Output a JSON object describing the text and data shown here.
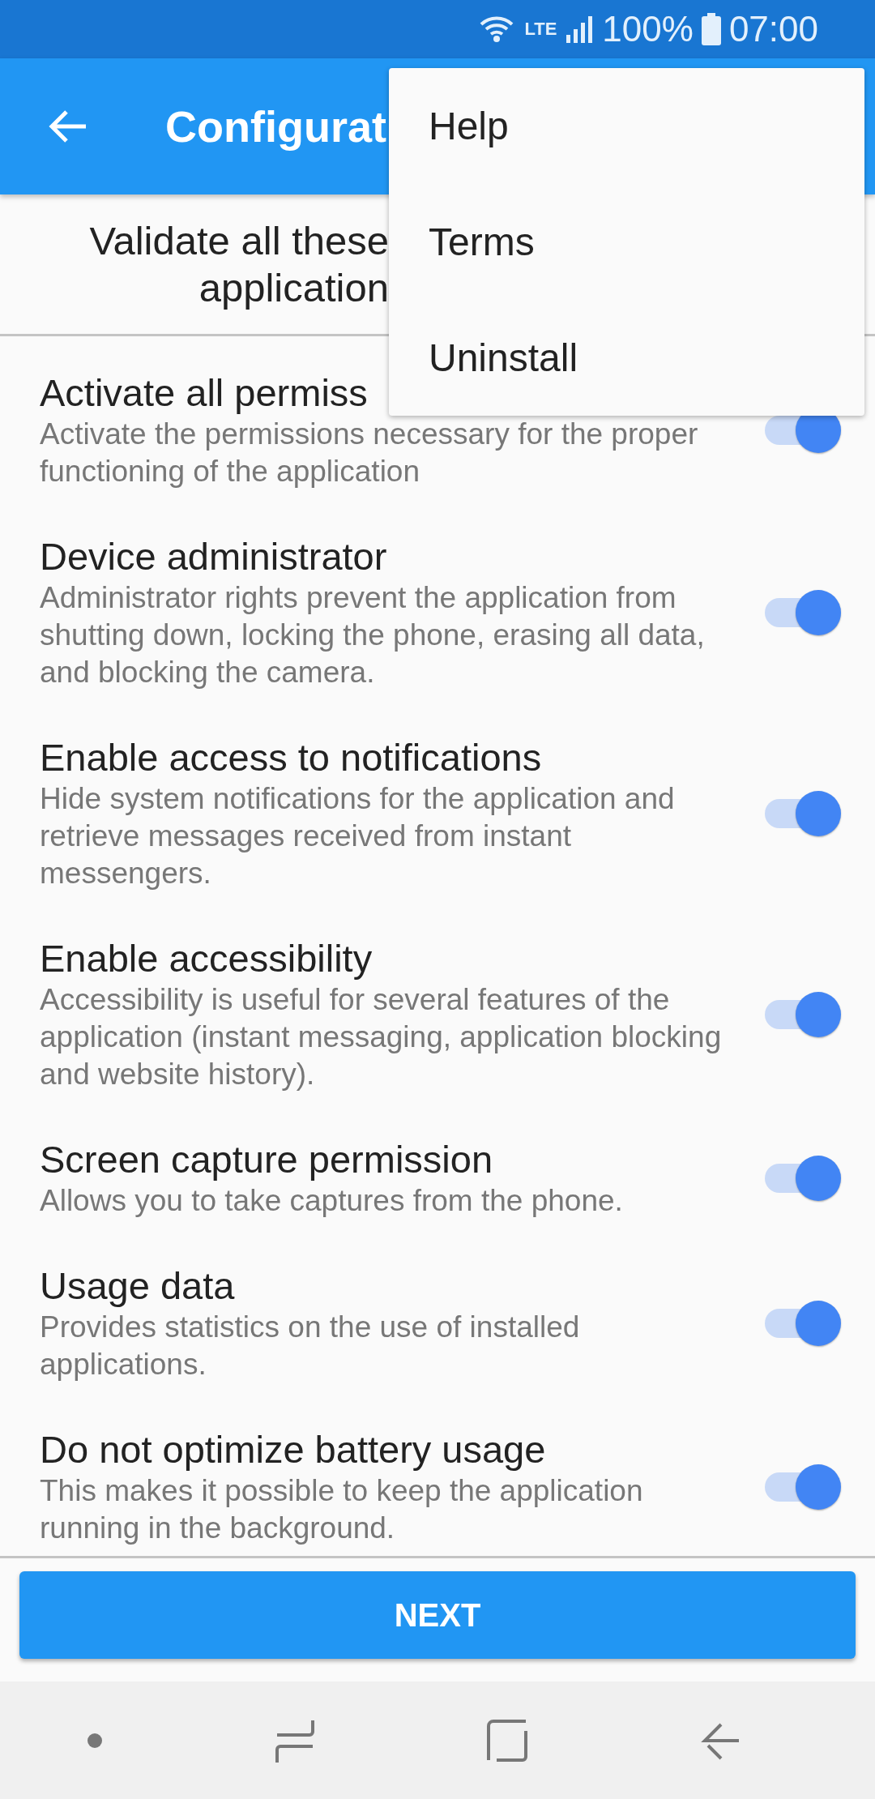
{
  "status_bar": {
    "network": "LTE",
    "battery": "100%",
    "time": "07:00"
  },
  "app_bar": {
    "title": "Configurat"
  },
  "header": {
    "lines": [
      "Validate all these",
      "application"
    ]
  },
  "permissions": [
    {
      "title": "Activate all permiss",
      "description": "Activate the permissions necessary for the proper functioning of the application",
      "on": true
    },
    {
      "title": "Device administrator",
      "description": "Administrator rights prevent the application from shutting down, locking the phone, erasing all data, and blocking the camera.",
      "on": true
    },
    {
      "title": "Enable access to notifications",
      "description": "Hide system notifications for the application and retrieve messages received from instant messengers.",
      "on": true
    },
    {
      "title": "Enable accessibility",
      "description": "Accessibility is useful for several features of the application (instant messaging, application blocking and website history).",
      "on": true
    },
    {
      "title": "Screen capture permission",
      "description": "Allows you to take captures from the phone.",
      "on": true
    },
    {
      "title": "Usage data",
      "description": "Provides statistics on the use of installed applications.",
      "on": true
    },
    {
      "title": "Do not optimize battery usage",
      "description": "This makes it possible to keep the application running in the background.",
      "on": true
    }
  ],
  "next_button": "NEXT",
  "menu": {
    "items": [
      "Help",
      "Terms",
      "Uninstall"
    ]
  }
}
